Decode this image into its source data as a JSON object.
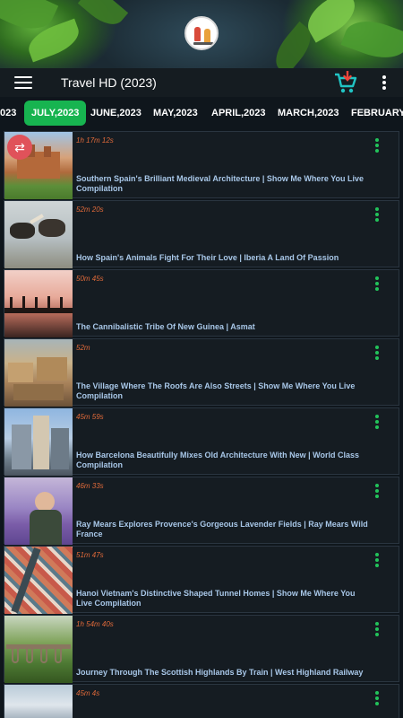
{
  "app": {
    "title": "Travel HD (2023)"
  },
  "icons": {
    "menu": "hamburger-menu-icon",
    "cart": "cart-download-icon",
    "more": "more-vertical-icon",
    "shuffle": "shuffle-icon"
  },
  "colors": {
    "accent": "#17b450",
    "duration": "#e06a3a",
    "title_text": "#a8c7e8",
    "fab": "#e0525a"
  },
  "tabs": [
    {
      "label": "023"
    },
    {
      "label": "JULY,2023",
      "active": true
    },
    {
      "label": "JUNE,2023"
    },
    {
      "label": "MAY,2023"
    },
    {
      "label": "APRIL,2023"
    },
    {
      "label": "MARCH,2023"
    },
    {
      "label": "FEBRUARY,2"
    }
  ],
  "videos": [
    {
      "duration": "1h 17m 12s",
      "title": "Southern Spain's Brilliant Medieval Architecture | Show Me Where You Live Compilation"
    },
    {
      "duration": "52m 20s",
      "title": "How Spain's Animals Fight For Their Love | Iberia A Land Of Passion"
    },
    {
      "duration": "50m 45s",
      "title": "The Cannibalistic Tribe Of New Guinea | Asmat"
    },
    {
      "duration": "52m",
      "title": "The Village Where The Roofs Are Also Streets | Show Me Where You Live Compilation"
    },
    {
      "duration": "45m 59s",
      "title": "How Barcelona Beautifully Mixes Old Architecture With New | World Class Compilation"
    },
    {
      "duration": "46m 33s",
      "title": "Ray Mears Explores Provence's Gorgeous Lavender Fields | Ray Mears Wild France"
    },
    {
      "duration": "51m 47s",
      "title": "Hanoi Vietnam's Distinctive Shaped Tunnel Homes | Show Me Where You Live Compilation"
    },
    {
      "duration": "1h 54m 40s",
      "title": "Journey Through The Scottish Highlands By Train | West Highland Railway"
    },
    {
      "duration": "45m 4s",
      "title": ""
    }
  ]
}
